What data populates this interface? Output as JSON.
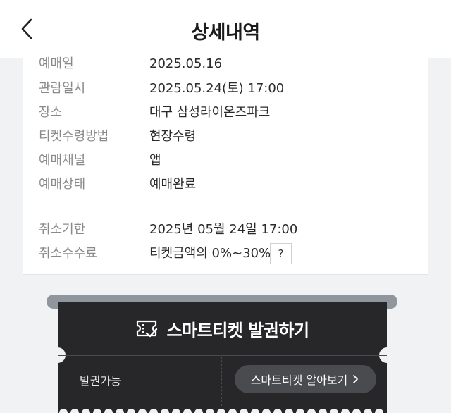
{
  "header": {
    "title": "상세내역",
    "back_icon": "chevron-left-icon"
  },
  "details": [
    {
      "label": "예매일",
      "value": "2025.05.16"
    },
    {
      "label": "관람일시",
      "value": "2025.05.24(토) 17:00"
    },
    {
      "label": "장소",
      "value": "대구 삼성라이온즈파크"
    },
    {
      "label": "티켓수령방법",
      "value": "현장수령"
    },
    {
      "label": "예매채널",
      "value": "앱"
    },
    {
      "label": "예매상태",
      "value": "예매완료"
    }
  ],
  "cancel": [
    {
      "label": "취소기한",
      "value": "2025년 05월 24일 17:00"
    },
    {
      "label": "취소수수료",
      "value": "티켓금액의 0%~30%"
    }
  ],
  "help_button": "?",
  "ticket": {
    "title": "스마트티켓 발권하기",
    "status": "발권가능",
    "learn_more": "스마트티켓 알아보기",
    "icon": "ticket-icon",
    "arrow_icon": "chevron-right-icon"
  },
  "colors": {
    "ticket_bg": "#27272a",
    "page_bg": "#f1f2f4",
    "label": "#8a8a8a"
  }
}
